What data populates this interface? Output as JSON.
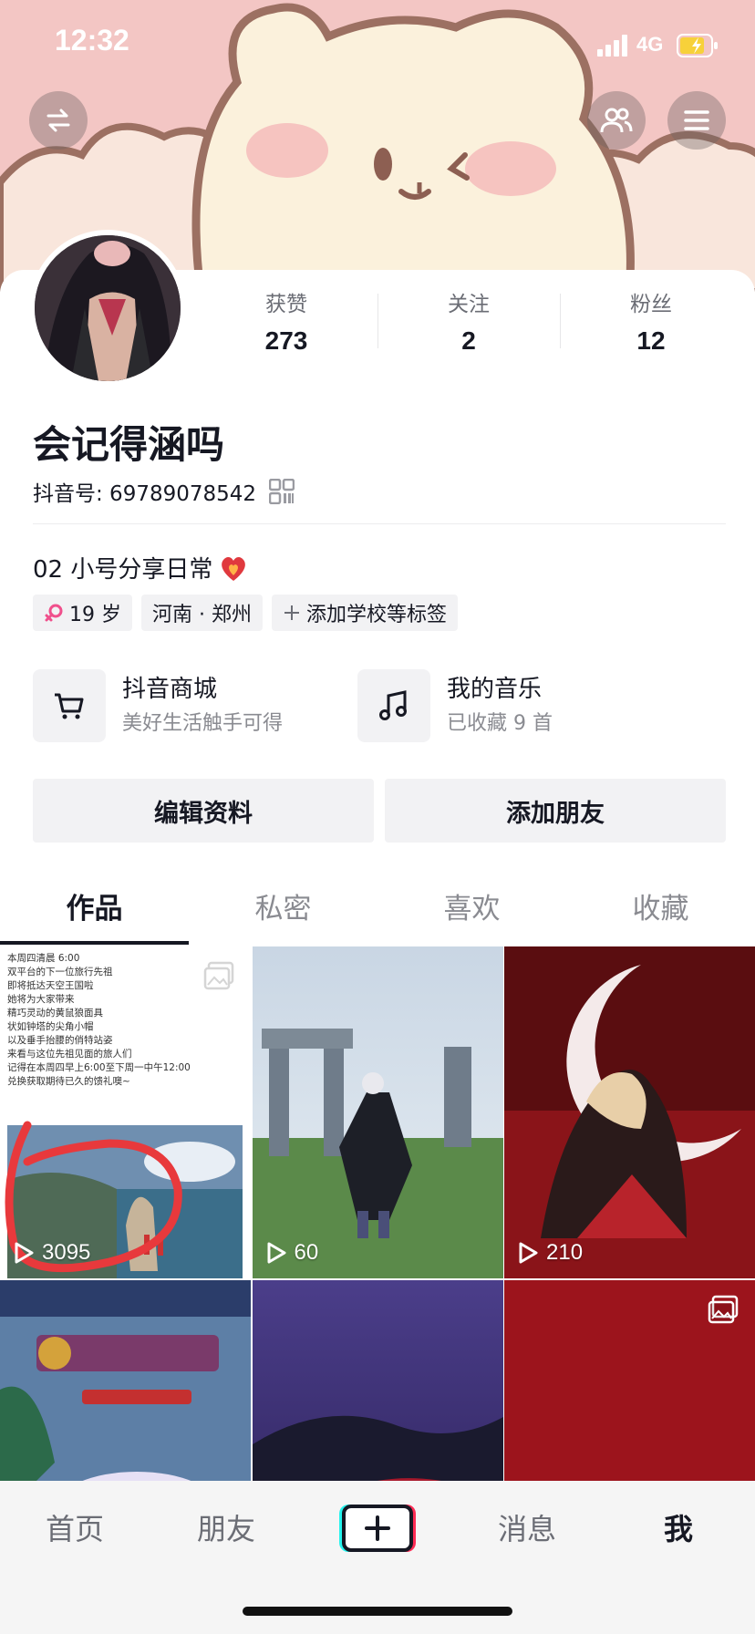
{
  "status_bar": {
    "time": "12:32",
    "network": "4G"
  },
  "profile": {
    "stats": [
      {
        "label": "获赞",
        "value": "273"
      },
      {
        "label": "关注",
        "value": "2"
      },
      {
        "label": "粉丝",
        "value": "12"
      }
    ],
    "nickname": "会记得涵吗",
    "douyin_id": "抖音号: 69789078542",
    "bio": "02 小号分享日常",
    "tags": {
      "age": "19 岁",
      "location": "河南 · 郑州",
      "add": "添加学校等标签"
    }
  },
  "services": [
    {
      "title": "抖音商城",
      "subtitle": "美好生活触手可得"
    },
    {
      "title": "我的音乐",
      "subtitle": "已收藏 9 首"
    }
  ],
  "actions": {
    "edit": "编辑资料",
    "add_friend": "添加朋友"
  },
  "tabs": [
    "作品",
    "私密",
    "喜欢",
    "收藏"
  ],
  "grid": {
    "note_text": "本周四清晨 6:00\n双平台的下一位旅行先祖\n即将抵达天空王国啦\n她将为大家带来\n精巧灵动的黄鼠狼面具\n状如钟塔的尖角小帽\n以及垂手抬腰的俏特站姿\n来看与这位先祖见面的旅人们\n记得在本周四早上6:00至下周一中午12:00\n兑换获取期待已久的馈礼噢~",
    "plays": [
      "3095",
      "60",
      "210"
    ]
  },
  "tabbar": [
    "首页",
    "朋友",
    "消息",
    "我"
  ],
  "colors": {
    "brand_cyan": "#25f4ee",
    "brand_red": "#fe2c55",
    "banner": "#f4c9c6"
  }
}
